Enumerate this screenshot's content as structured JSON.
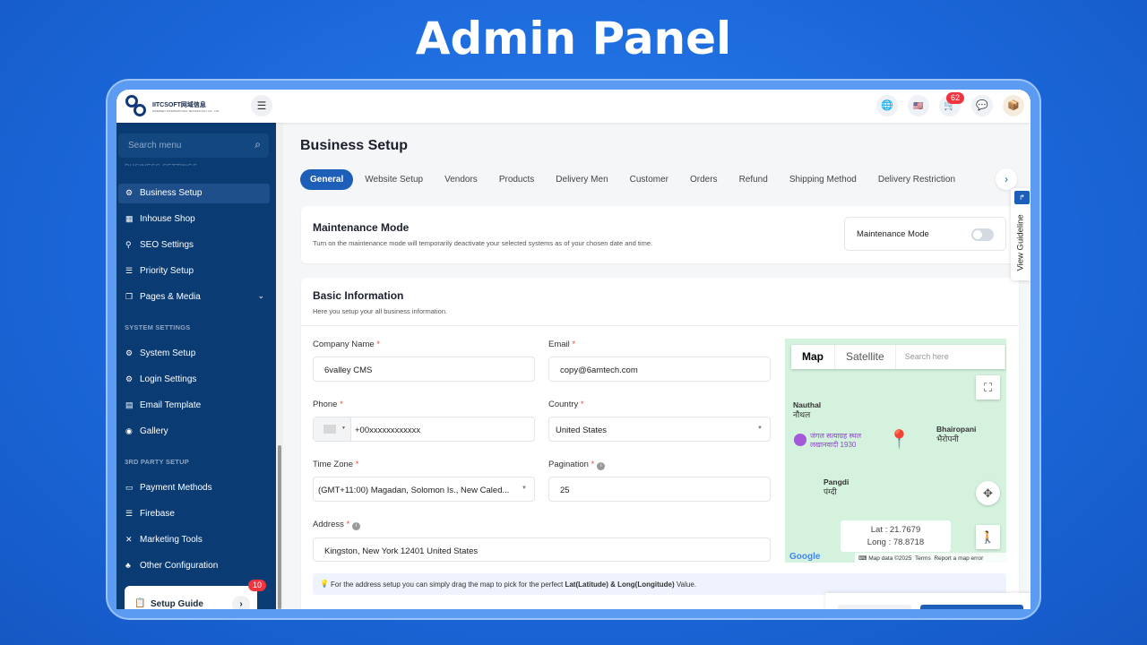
{
  "banner_title": "Admin Panel",
  "header": {
    "logo_text": "IITCSOFT网域信息",
    "logo_sub": "INTERNET INTERNATIONAL TECHNOLOGY CO., LTD",
    "cart_count": "62"
  },
  "sidebar": {
    "search_placeholder": "Search menu",
    "section_business": "BUSINESS SETTINGS",
    "business_items": [
      {
        "label": "Business Setup",
        "icon": "gear"
      },
      {
        "label": "Inhouse Shop",
        "icon": "shop"
      },
      {
        "label": "SEO Settings",
        "icon": "seo"
      },
      {
        "label": "Priority Setup",
        "icon": "list"
      },
      {
        "label": "Pages & Media",
        "icon": "pages"
      }
    ],
    "section_system": "SYSTEM SETTINGS",
    "system_items": [
      {
        "label": "System Setup",
        "icon": "gear"
      },
      {
        "label": "Login Settings",
        "icon": "gear"
      },
      {
        "label": "Email Template",
        "icon": "email"
      },
      {
        "label": "Gallery",
        "icon": "gallery"
      }
    ],
    "section_third": "3RD PARTY SETUP",
    "third_items": [
      {
        "label": "Payment Methods",
        "icon": "card"
      },
      {
        "label": "Firebase",
        "icon": "database"
      },
      {
        "label": "Marketing Tools",
        "icon": "tools"
      },
      {
        "label": "Other Configuration",
        "icon": "sitemap"
      }
    ],
    "setup_guide": {
      "label": "Setup Guide",
      "badge": "10"
    }
  },
  "main": {
    "title": "Business Setup",
    "tabs": [
      "General",
      "Website Setup",
      "Vendors",
      "Products",
      "Delivery Men",
      "Customer",
      "Orders",
      "Refund",
      "Shipping Method",
      "Delivery Restriction"
    ],
    "active_tab": "General",
    "maintenance": {
      "title": "Maintenance Mode",
      "subtitle": "Turn on the maintenance mode will temporarily deactivate your selected systems as of your chosen date and time.",
      "toggle_label": "Maintenance Mode",
      "enabled": false
    },
    "basic": {
      "title": "Basic Information",
      "subtitle": "Here you setup your all business information.",
      "company_name_label": "Company Name",
      "company_name": "6valley CMS",
      "email_label": "Email",
      "email": "copy@6amtech.com",
      "phone_label": "Phone",
      "phone": "+00xxxxxxxxxxxx",
      "country_label": "Country",
      "country": "United States",
      "timezone_label": "Time Zone",
      "timezone": "(GMT+11:00) Magadan, Solomon Is., New Caled...",
      "pagination_label": "Pagination",
      "pagination": "25",
      "address_label": "Address",
      "address": "Kingston, New York 12401 United States",
      "hint_prefix": "For the address setup you can simply drag the map to pick for the perfect ",
      "hint_bold": "Lat(Latitude) & Long(Longitude)",
      "hint_suffix": " Value."
    },
    "map": {
      "map_tab": "Map",
      "satellite_tab": "Satellite",
      "search_placeholder": "Search here",
      "places": [
        {
          "name": "Nauthal",
          "local": "नौथल"
        },
        {
          "name": "Bhairopani",
          "local": "भैरोपनी"
        },
        {
          "name": "Pangdi",
          "local": "पंग्दी"
        }
      ],
      "poi": "जंगल सत्याग्रह स्थल लखानवादी 1930",
      "lat": "Lat : 21.7679",
      "long": "Long : 78.8718",
      "footer_data": "Map data ©2025",
      "footer_terms": "Terms",
      "footer_report": "Report a map error",
      "google": "Google"
    },
    "view_guideline": "View Guideline"
  },
  "colors": {
    "primary": "#1d5fb8",
    "sidebar": "#0b3b73",
    "badge": "#f0353f"
  }
}
